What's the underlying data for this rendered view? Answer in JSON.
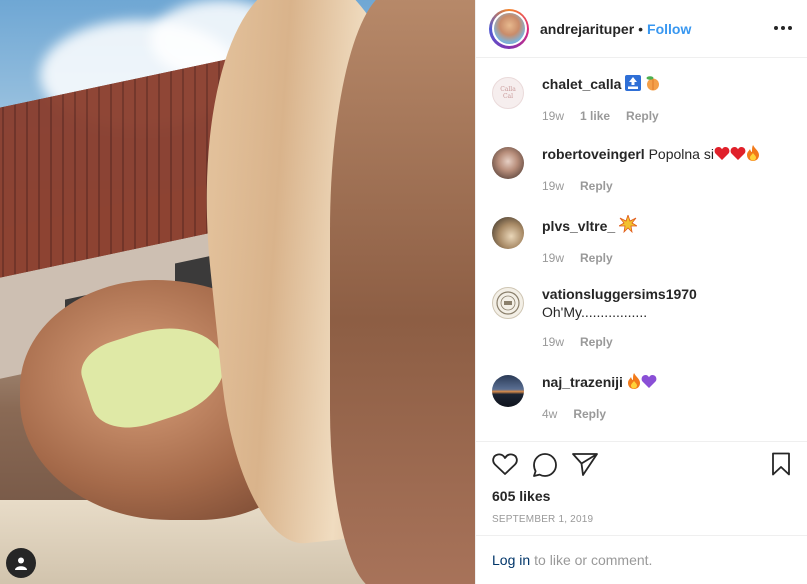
{
  "post": {
    "username": "andrejarituper",
    "separator": "•",
    "follow_label": "Follow",
    "likes": "605 likes",
    "date": "September 1, 2019"
  },
  "comments": [
    {
      "user": "chalet_calla",
      "text": "",
      "emojis": [
        "top-arrow-emoji",
        "peach-emoji"
      ],
      "age": "19w",
      "likes": "1 like",
      "reply": "Reply",
      "avatar_text": "Calla Cal"
    },
    {
      "user": "robertoveingerl",
      "text": "Popolna si",
      "emojis": [
        "red-heart-emoji",
        "red-heart-emoji",
        "fire-emoji"
      ],
      "age": "19w",
      "likes": "",
      "reply": "Reply"
    },
    {
      "user": "plvs_vltre_",
      "text": "",
      "emojis": [
        "collision-emoji"
      ],
      "age": "19w",
      "likes": "",
      "reply": "Reply"
    },
    {
      "user": "vationsluggersims1970",
      "text": "Oh'My.................",
      "emojis": [],
      "age": "19w",
      "likes": "",
      "reply": "Reply"
    },
    {
      "user": "naj_trazeniji",
      "text": "",
      "emojis": [
        "fire-emoji",
        "purple-heart-emoji"
      ],
      "age": "4w",
      "likes": "",
      "reply": "Reply"
    }
  ],
  "login": {
    "link": "Log in",
    "rest": "to like or comment."
  },
  "colors": {
    "link_blue": "#3897f0",
    "text": "#262626",
    "muted": "#999999",
    "border": "#efefef",
    "login_link": "#003569"
  }
}
